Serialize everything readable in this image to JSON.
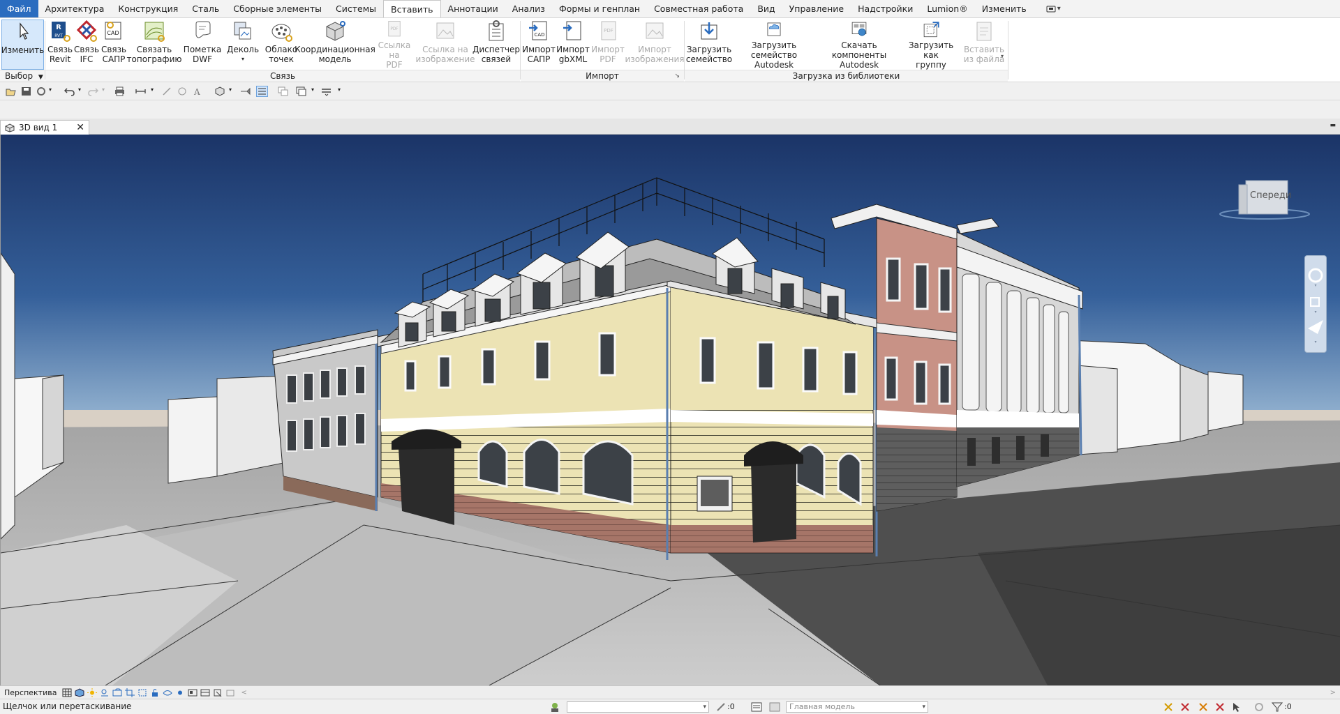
{
  "menu": {
    "file": "Файл",
    "tabs": [
      "Архитектура",
      "Конструкция",
      "Сталь",
      "Сборные элементы",
      "Системы",
      "Вставить",
      "Аннотации",
      "Анализ",
      "Формы и генплан",
      "Совместная работа",
      "Вид",
      "Управление",
      "Надстройки",
      "Lumion®",
      "Изменить"
    ],
    "active_index": 5
  },
  "ribbon": {
    "modify": "Изменить",
    "select_group": "Выбор",
    "link_group": "Связь",
    "import_group": "Импорт",
    "library_group": "Загрузка из библиотеки",
    "buttons": {
      "link_revit": [
        "Связь",
        "Revit"
      ],
      "link_ifc": [
        "Связь",
        "IFC"
      ],
      "link_cad": [
        "Связь",
        "САПР"
      ],
      "link_topo": [
        "Связать",
        "топографию"
      ],
      "dwf_markup": [
        "Пометка",
        "DWF"
      ],
      "decal": [
        "Деколь",
        ""
      ],
      "point_cloud": [
        "Облако",
        "точек"
      ],
      "coord_model": [
        "Координационная",
        "модель"
      ],
      "link_pdf": [
        "Ссылка на",
        "PDF"
      ],
      "link_image": [
        "Ссылка на",
        "изображение"
      ],
      "manage_links": [
        "Диспетчер",
        "связей"
      ],
      "import_cad": [
        "Импорт",
        "САПР"
      ],
      "import_gbxml": [
        "Импорт",
        "gbXML"
      ],
      "import_pdf": [
        "Импорт",
        "PDF"
      ],
      "import_image": [
        "Импорт",
        "изображения"
      ],
      "load_family": [
        "Загрузить",
        "семейство"
      ],
      "load_autodesk_family": [
        "Загрузить семейство",
        "Autodesk"
      ],
      "download_components": [
        "Скачать компоненты",
        "Autodesk"
      ],
      "load_as_group": [
        "Загрузить как",
        "группу"
      ],
      "insert_from_file": [
        "Вставить",
        "из файла"
      ]
    }
  },
  "view_tab": {
    "title": "3D вид 1"
  },
  "viewcube": {
    "face_label": "Спереди"
  },
  "view_control": {
    "projection": "Перспектива"
  },
  "status": {
    "message": "Щелчок или перетаскивание",
    "selection_count": ":0",
    "model_placeholder": "Главная модель",
    "filter_count": ":0"
  },
  "colors": {
    "accent": "#2a6cbf",
    "sky_top": "#1b3467",
    "sky_bottom": "#88a8c8",
    "facade_yellow": "#ece3b4",
    "facade_pink": "#c89286",
    "base_brick": "#a67568"
  }
}
